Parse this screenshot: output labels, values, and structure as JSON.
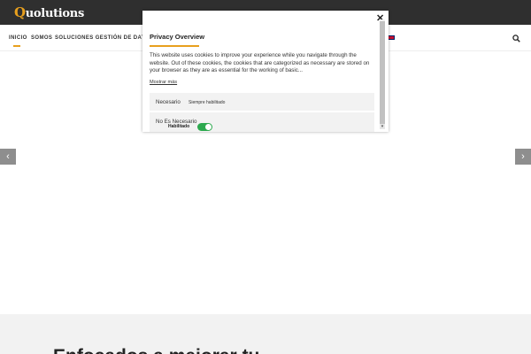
{
  "header": {
    "logo_initial": "Q",
    "logo_rest": "uolutions"
  },
  "nav": {
    "items": [
      {
        "label": "INICIO"
      },
      {
        "label": "SOMOS"
      },
      {
        "label": "SOLUCIONES GESTIÓN DE DATOS"
      }
    ],
    "language_flag": "uk-flag-icon",
    "search_icon": "search-icon"
  },
  "slider": {
    "prev_arrow": "‹",
    "next_arrow": "›"
  },
  "section": {
    "heading": "Enfocados a mejorar tu"
  },
  "privacy_modal": {
    "close_label": "✕",
    "title": "Privacy Overview",
    "body": "This website uses cookies to improve your experience while you navigate through the website. Out of these cookies, the cookies that are categorized as necessary are stored on your browser as they are as essential for the working of basic...",
    "show_more": "Mostrar más",
    "categories": [
      {
        "name": "Necesario",
        "status": "Siempre habilitado"
      },
      {
        "name": "No Es Necesario",
        "toggle_label": "Habilitado",
        "enabled": true
      }
    ]
  },
  "colors": {
    "accent": "#e8a01e",
    "topbar": "#2f2f2f",
    "toggle_on": "#2da94f"
  }
}
